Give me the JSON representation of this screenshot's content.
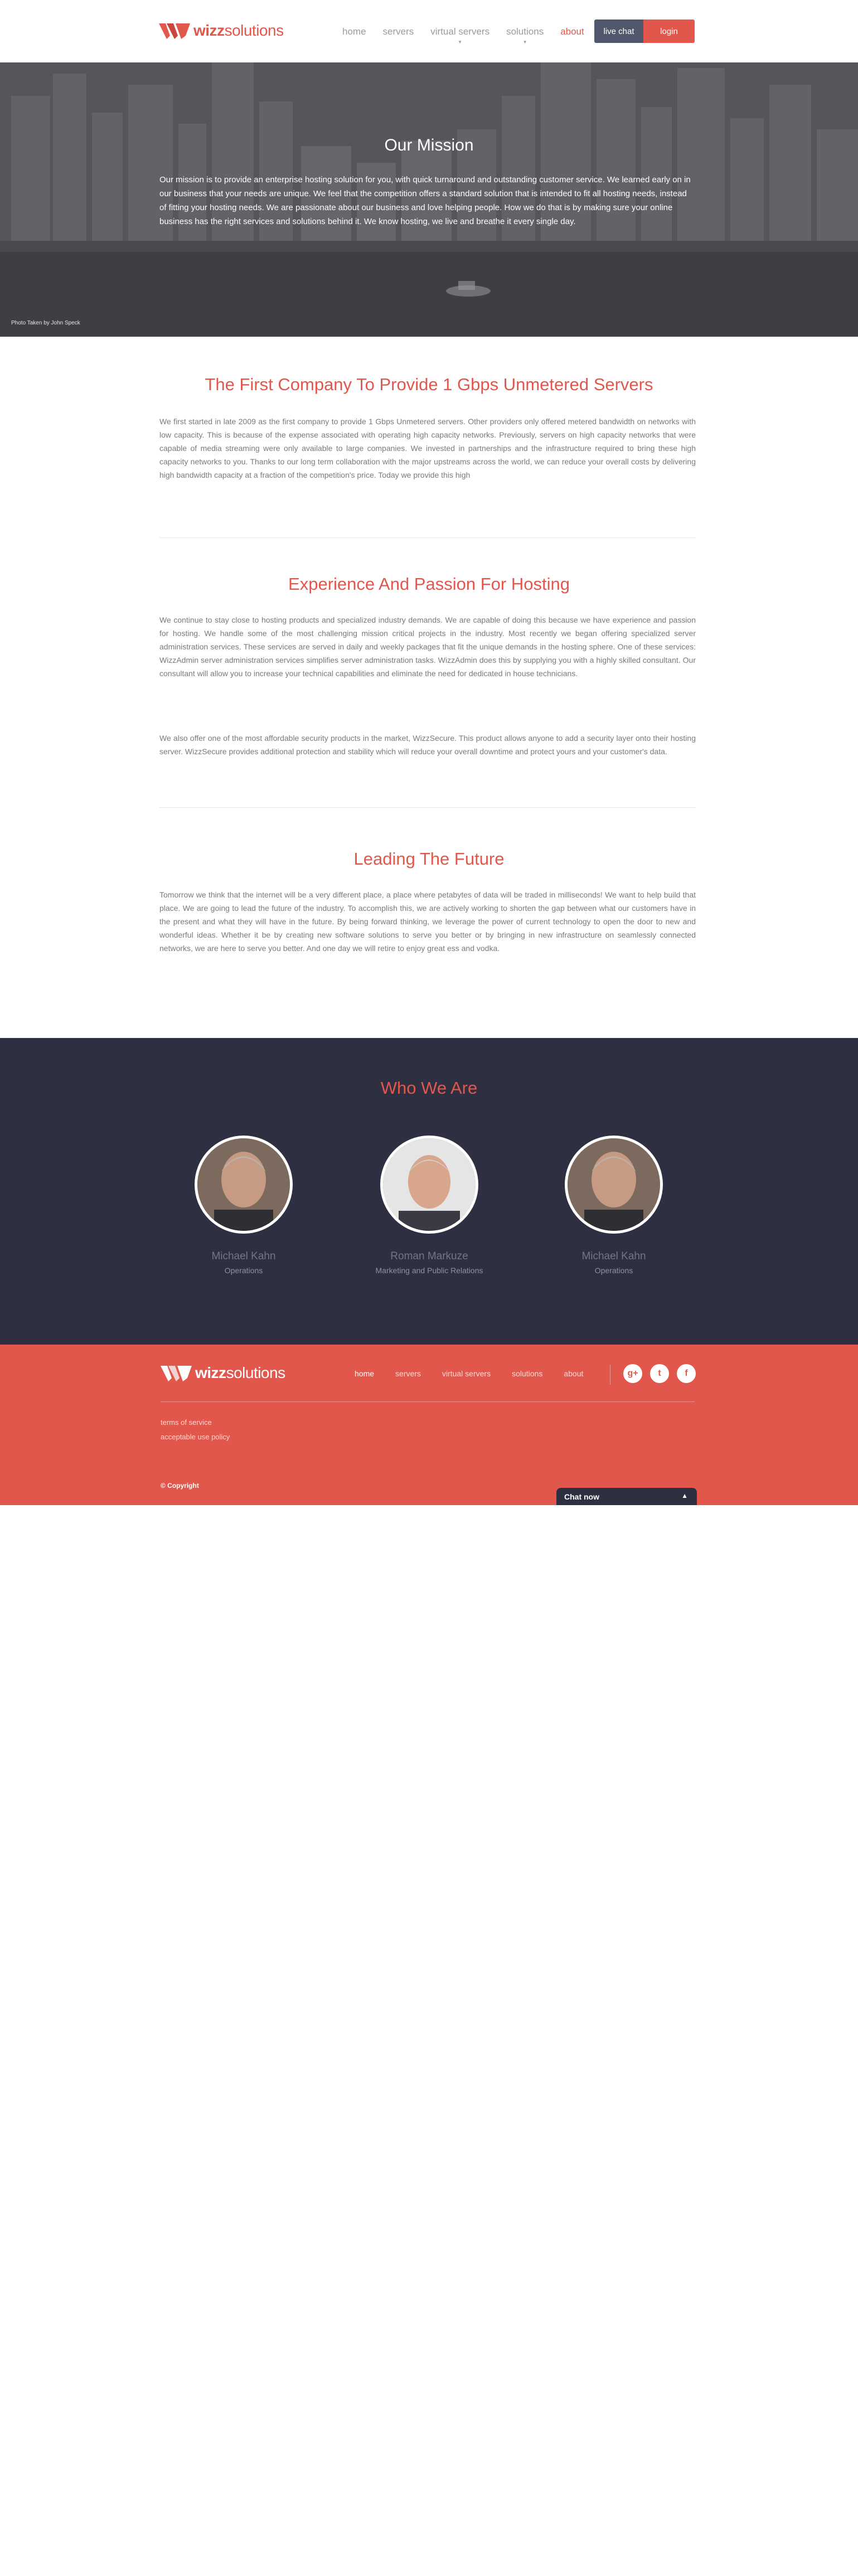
{
  "header": {
    "logo_text_a": "wizz",
    "logo_text_b": "solutions",
    "nav": [
      "home",
      "servers",
      "virtual servers",
      "solutions",
      "about"
    ],
    "live_chat": "live chat",
    "login": "login"
  },
  "hero": {
    "title": "Our Mission",
    "text": "Our mission is to provide an enterprise hosting solution for you, with quick turnaround and outstanding customer service. We learned early on in our business that your needs are unique. We feel that the competition offers a standard solution that is intended to fit all hosting needs, instead of fitting your hosting needs. We are passionate about our business and love helping people. How we do that is by making sure your online business has the right services and solutions behind it. We know hosting, we live and breathe it every single day.",
    "credit": "Photo Taken by John Speck"
  },
  "sections": [
    {
      "title": "The First Company To Provide 1 Gbps Unmetered Servers",
      "paragraphs": [
        "We first started in late 2009 as the first company to provide 1 Gbps Unmetered servers. Other providers only offered metered bandwidth on networks with low capacity. This is because of the expense associated with operating high capacity networks. Previously, servers on high capacity networks that were capable of media streaming were only available to large companies. We invested in partnerships and the infrastructure required to bring these high capacity networks to you. Thanks to our long term collaboration with the major upstreams across the world, we can reduce your overall costs by delivering high bandwidth capacity at a fraction of the competition's price. Today we provide this high"
      ]
    },
    {
      "title": "Experience And Passion For Hosting",
      "paragraphs": [
        "We continue to stay close to hosting products and specialized industry demands. We are capable of doing this because we have experience and passion for hosting. We handle some of the most challenging mission critical projects in the industry. Most recently we began offering specialized server administration services. These services are served in daily and weekly packages that fit the unique demands in the hosting sphere. One of these services: WizzAdmin server administration services simplifies server administration tasks. WizzAdmin does this by supplying you with a highly skilled consultant. Our consultant will allow you to increase your technical capabilities and eliminate the need for dedicated in house technicians.",
        "We also offer one of the most affordable security products in the market, WizzSecure. This product allows anyone to add a security layer onto their hosting server. WizzSecure provides additional protection and stability which will reduce your overall downtime and protect yours and your customer's data."
      ]
    },
    {
      "title": "Leading The Future",
      "paragraphs": [
        "Tomorrow we think that the internet will be a very different place, a place where petabytes of data will be traded in milliseconds! We want to help build that place. We are going to lead the future of the industry. To accomplish this, we are actively working to shorten the gap between what our customers have in the present and what they will have in the future. By being forward thinking, we leverage the power of current technology to open the door to new and wonderful ideas. Whether it be by creating new software solutions to serve you better or by bringing in new infrastructure on seamlessly connected networks, we are here to serve you better. And one day we will retire to enjoy great ess and vodka."
      ]
    }
  ],
  "team": {
    "title": "Who We Are",
    "members": [
      {
        "name": "Michael Kahn",
        "role": "Operations"
      },
      {
        "name": "Roman Markuze",
        "role": "Marketing and Public Relations"
      },
      {
        "name": "Michael Kahn",
        "role": "Operations"
      }
    ]
  },
  "footer": {
    "nav": [
      "home",
      "servers",
      "virtual servers",
      "solutions",
      "about"
    ],
    "links": [
      "terms of service",
      "acceptable use policy"
    ],
    "copyright": "© Copyright",
    "chat": "Chat now",
    "social": [
      "google-plus-icon",
      "twitter-icon",
      "facebook-icon"
    ]
  },
  "colors": {
    "accent": "#e2574c",
    "dark": "#2f2f42",
    "chat_button": "#52586b"
  }
}
